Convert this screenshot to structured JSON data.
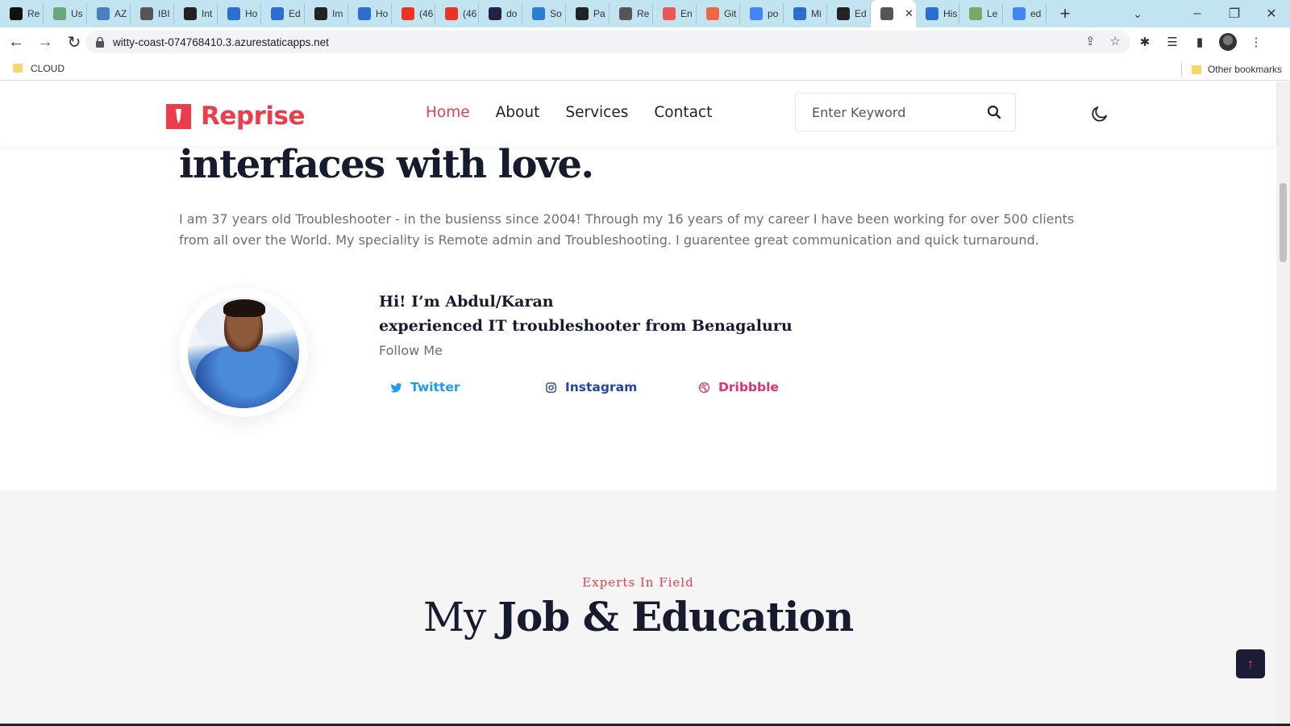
{
  "browser": {
    "tabs": [
      {
        "label": "Re",
        "fav": "#111",
        "icon": "terminal-icon"
      },
      {
        "label": "Us",
        "fav": "#6aa77a",
        "icon": "openai-icon"
      },
      {
        "label": "AZ",
        "fav": "#4a7fc0",
        "icon": "azure-icon"
      },
      {
        "label": "IBI",
        "fav": "#555",
        "icon": "ibm-icon"
      },
      {
        "label": "Int",
        "fav": "#222",
        "icon": "github-icon"
      },
      {
        "label": "Ho",
        "fav": "#2a6fd0",
        "icon": "azure-icon"
      },
      {
        "label": "Ed",
        "fav": "#2a6fd0",
        "icon": "azure-icon"
      },
      {
        "label": "Im",
        "fav": "#222",
        "icon": "github-icon"
      },
      {
        "label": "Ho",
        "fav": "#2a6fd0",
        "icon": "azure-icon"
      },
      {
        "label": "(46",
        "fav": "#e32",
        "icon": "youtube-icon"
      },
      {
        "label": "(46",
        "fav": "#e32",
        "icon": "youtube-icon"
      },
      {
        "label": "do",
        "fav": "#224",
        "icon": "w3-icon"
      },
      {
        "label": "So",
        "fav": "#2a7fd0",
        "icon": "vscode-icon"
      },
      {
        "label": "Pa",
        "fav": "#222",
        "icon": "github-icon"
      },
      {
        "label": "Re",
        "fav": "#555",
        "icon": "globe-icon"
      },
      {
        "label": "En",
        "fav": "#e55",
        "icon": "rainbow-icon"
      },
      {
        "label": "Git",
        "fav": "#e64",
        "icon": "git-icon"
      },
      {
        "label": "po",
        "fav": "#4285f4",
        "icon": "google-icon"
      },
      {
        "label": "Mi",
        "fav": "#2a6fd0",
        "icon": "azure-icon"
      },
      {
        "label": "Ed",
        "fav": "#222",
        "icon": "github-icon"
      },
      {
        "label": "",
        "fav": "#555",
        "icon": "globe-icon",
        "active": true
      },
      {
        "label": "His",
        "fav": "#2a6fd0",
        "icon": "history-icon"
      },
      {
        "label": "Le",
        "fav": "#7a6",
        "icon": "learn-icon"
      },
      {
        "label": "ed",
        "fav": "#4285f4",
        "icon": "google-icon"
      }
    ],
    "new_tab_label": "+",
    "url": "witty-coast-074768410.3.azurestaticapps.net",
    "bookmark_folder": "CLOUD",
    "other_bookmarks": "Other bookmarks"
  },
  "site": {
    "brand": "Reprise",
    "brand_color": "#ee3c4b",
    "nav": [
      {
        "label": "Home",
        "active": true
      },
      {
        "label": "About"
      },
      {
        "label": "Services"
      },
      {
        "label": "Contact"
      }
    ],
    "search_placeholder": "Enter Keyword"
  },
  "hero": {
    "title": "interfaces with love.",
    "description": "I am 37 years old Troubleshooter - in the busienss since 2004! Through my 16 years of my career I have been working for over 500 clients from all over the World. My speciality is Remote admin and Troubleshooting. I guarentee great communication and quick turnaround.",
    "greeting_line1": "Hi! I’m Abdul/Karan",
    "greeting_line2": "experienced IT troubleshooter from Benagaluru",
    "follow_label": "Follow Me",
    "social": {
      "twitter": "Twitter",
      "instagram": "Instagram",
      "dribbble": "Dribbble"
    }
  },
  "section2": {
    "kicker": "Experts In Field",
    "title_prefix": "My",
    "title_bold": "Job & Education"
  },
  "back_to_top": "↑"
}
